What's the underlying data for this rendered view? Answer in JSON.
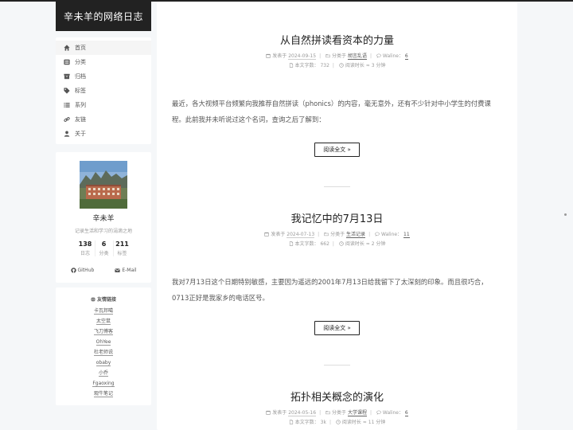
{
  "site": {
    "title": "辛未羊的网络日志"
  },
  "menu": [
    {
      "label": "首页",
      "icon": "home-icon",
      "active": true
    },
    {
      "label": "分类",
      "icon": "category-icon"
    },
    {
      "label": "归档",
      "icon": "archive-icon"
    },
    {
      "label": "标签",
      "icon": "tag-icon"
    },
    {
      "label": "系列",
      "icon": "list-icon"
    },
    {
      "label": "友链",
      "icon": "link-icon"
    },
    {
      "label": "关于",
      "icon": "user-icon"
    }
  ],
  "profile": {
    "name": "辛未羊",
    "description": "记录生活和学习的涓滴之地",
    "stats": [
      {
        "num": "138",
        "label": "日志"
      },
      {
        "num": "6",
        "label": "分类"
      },
      {
        "num": "211",
        "label": "标签"
      }
    ],
    "github": "GitHub",
    "email": "E-Mail"
  },
  "friends": {
    "title": "友情链接",
    "items": [
      "卡瓦邦噶",
      "太空鼠",
      "飞刀博客",
      "OhYee",
      "杜老师说",
      "obaby",
      "小乔",
      "Fgaoxing",
      "观牛笔记"
    ]
  },
  "labels": {
    "posted": "发表于",
    "category": "分类于",
    "comments": "Waline：",
    "words": "本文字数：",
    "readtime": "阅读时长 ≈",
    "readmore": "阅读全文 »"
  },
  "posts": [
    {
      "title": "从自然拼读看资本的力量",
      "date": "2024-09-15",
      "category": "胡言乱语",
      "comments": "6",
      "words": "732",
      "readtime": "3 分钟",
      "excerpt": "最近，各大视频平台频繁向我推荐自然拼读（phonics）的内容，毫无意外，还有不少针对中小学生的付费课程。此前我并未听说过这个名词，查询之后了解到："
    },
    {
      "title": "我记忆中的7月13日",
      "date": "2024-07-13",
      "category": "生活记录",
      "comments": "11",
      "words": "662",
      "readtime": "2 分钟",
      "excerpt": "我对7月13日这个日期特别敏感，主要因为遥远的2001年7月13日给我留下了太深刻的印象。而且很巧合，0713正好是我家乡的电话区号。"
    },
    {
      "title": "拓扑相关概念的演化",
      "date": "2024-05-16",
      "category": "大学课程",
      "comments": "6",
      "words": "3k",
      "readtime": "11 分钟"
    }
  ]
}
